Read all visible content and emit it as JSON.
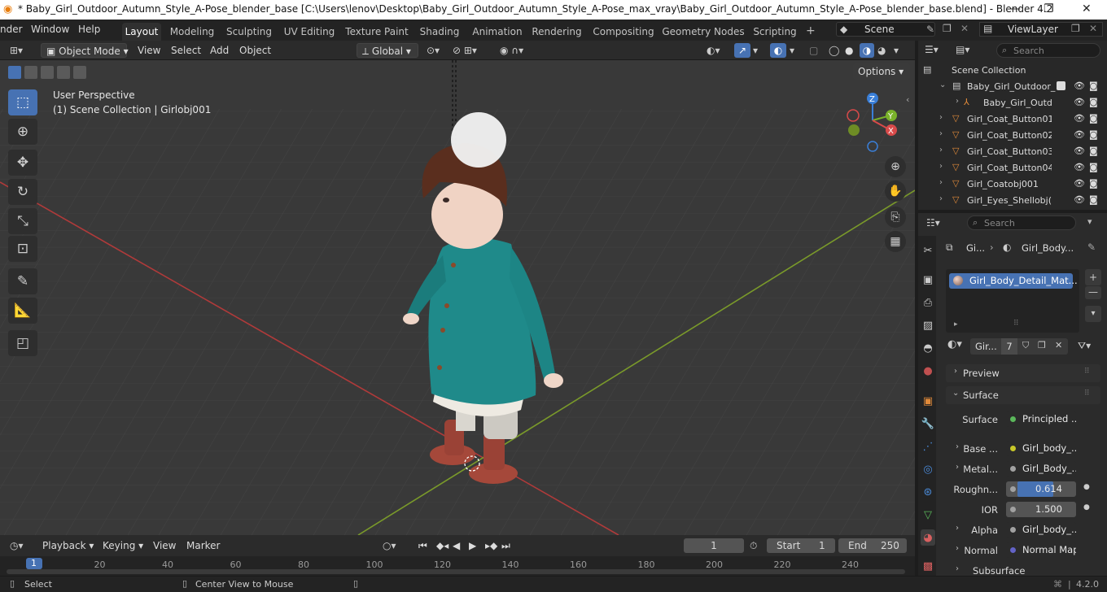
{
  "window": {
    "title": "* Baby_Girl_Outdoor_Autumn_Style_A-Pose_blender_base [C:\\Users\\lenov\\Desktop\\Baby_Girl_Outdoor_Autumn_Style_A-Pose_max_vray\\Baby_Girl_Outdoor_Autumn_Style_A-Pose_blender_base.blend] - Blender 4.2",
    "minimize": "—",
    "maximize": "❐",
    "close": "✕"
  },
  "menu": {
    "render": "nder",
    "window": "Window",
    "help": "Help"
  },
  "workspaces": [
    "Layout",
    "Modeling",
    "Sculpting",
    "UV Editing",
    "Texture Paint",
    "Shading",
    "Animation",
    "Rendering",
    "Compositing",
    "Geometry Nodes",
    "Scripting"
  ],
  "scene": {
    "name": "Scene",
    "view_layer": "ViewLayer"
  },
  "viewport_header": {
    "mode": "Object Mode",
    "view": "View",
    "select": "Select",
    "add": "Add",
    "object": "Object",
    "orientation": "Global",
    "options": "Options"
  },
  "viewport": {
    "perspective": "User Perspective",
    "collection_info": "(1) Scene Collection | Girlobj001",
    "gizmo": {
      "x": "X",
      "y": "Y",
      "z": "Z"
    }
  },
  "outliner": {
    "search_placeholder": "Search",
    "root": "Scene Collection",
    "items": [
      "Baby_Girl_Outdoor_",
      "Baby_Girl_Outd",
      "Girl_Coat_Button01",
      "Girl_Coat_Button02",
      "Girl_Coat_Button03",
      "Girl_Coat_Button04",
      "Girl_Coatobj001",
      "Girl_Eyes_Shellobj("
    ]
  },
  "properties": {
    "search_placeholder": "Search",
    "breadcrumb_object": "Gi...",
    "breadcrumb_material": "Girl_Body...",
    "material_slot": "Girl_Body_Detail_Mat...",
    "material_name": "Gir...",
    "user_count": "7",
    "panels": {
      "preview": "Preview",
      "surface": "Surface",
      "subsurface": "Subsurface"
    },
    "fields": [
      {
        "label": "Surface",
        "value": "Principled ...",
        "dot": "#5bb85b"
      },
      {
        "label": "Base ...",
        "value": "Girl_body_...",
        "dot": "#c7c729"
      },
      {
        "label": "Metal...",
        "value": "Girl_Body_...",
        "dot": "#a1a1a1"
      },
      {
        "label": "Roughn...",
        "value": "0.614",
        "dot": "#a1a1a1"
      },
      {
        "label": "IOR",
        "value": "1.500",
        "dot": "#a1a1a1"
      },
      {
        "label": "Alpha",
        "value": "Girl_body_...",
        "dot": "#a1a1a1"
      },
      {
        "label": "Normal",
        "value": "Normal Map",
        "dot": "#6363c7"
      }
    ],
    "roughness_fraction": 0.614
  },
  "timeline": {
    "playback": "Playback",
    "keying": "Keying",
    "view": "View",
    "marker": "Marker",
    "current_frame": "1",
    "start_label": "Start",
    "start": "1",
    "end_label": "End",
    "end": "250",
    "ticks": [
      "1",
      "20",
      "40",
      "60",
      "80",
      "100",
      "120",
      "140",
      "160",
      "180",
      "200",
      "220",
      "240"
    ]
  },
  "status": {
    "select": "Select",
    "center": "Center View to Mouse",
    "version": "4.2.0"
  },
  "colors": {
    "accent": "#4772b3",
    "coat": "#1f8a8a",
    "hat": "#5a2e1e",
    "boots": "#a5483a",
    "grid_x": "#b03a3a",
    "grid_y": "#7a9a2a"
  }
}
